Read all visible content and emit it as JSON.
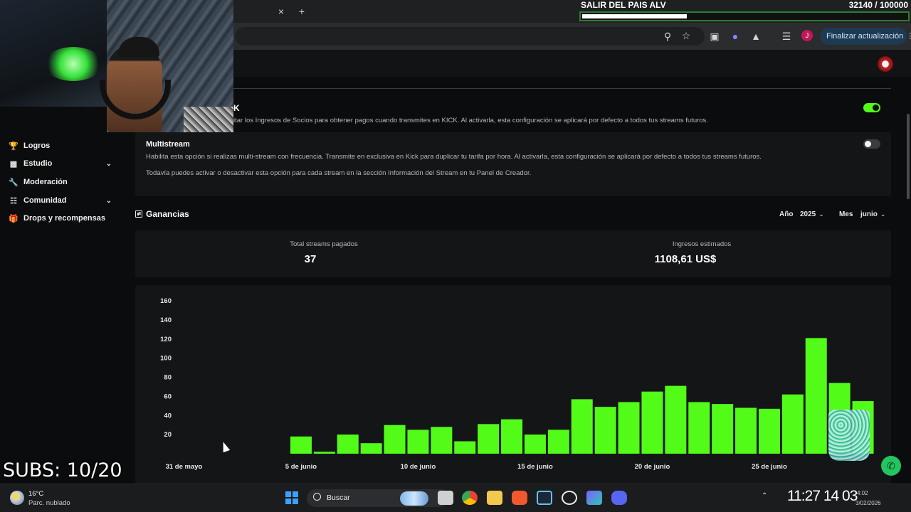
{
  "goal": {
    "title": "SALIR DEL PAIS ALV",
    "count": "32140 / 100000",
    "progress": 0.3214
  },
  "browser": {
    "update_label": "Finalizar actualización",
    "profile_initial": "J",
    "tab_close": "×",
    "new_tab": "+"
  },
  "partner": {
    "title_tail": "K",
    "description": "itar los Ingresos de Socios para obtener pagos cuando transmites en KICK. Al activarla, esta configuración se aplicará por defecto a todos tus streams futuros.",
    "enabled": true
  },
  "sidebar": {
    "items": [
      {
        "label": "Logros",
        "icon": "trophy-icon",
        "expandable": false
      },
      {
        "label": "Estudio",
        "icon": "video-icon",
        "expandable": true
      },
      {
        "label": "Moderación",
        "icon": "wrench-icon",
        "expandable": false
      },
      {
        "label": "Comunidad",
        "icon": "community-icon",
        "expandable": true
      },
      {
        "label": "Drops y recompensas",
        "icon": "gift-icon",
        "expandable": false
      }
    ]
  },
  "multistream": {
    "title": "Multistream",
    "description": "Habilita esta opción si realizas multi-stream con frecuencia. Transmite en exclusiva en Kick para duplicar tu tarifa por hora. Al activarla, esta configuración se aplicará por defecto a todos tus streams futuros.",
    "note": "Todavía puedes activar o desactivar esta opción para cada stream en la sección Información del Stream en tu Panel de Creador.",
    "enabled": false
  },
  "earnings": {
    "title": "Ganancias",
    "year_label": "Año",
    "year_value": "2025",
    "month_label": "Mes",
    "month_value": "junio",
    "stats": {
      "streams_label": "Total streams pagados",
      "streams_value": "37",
      "income_label": "Ingresos estimados",
      "income_value": "1108,61 US$"
    }
  },
  "chart_data": {
    "type": "bar",
    "color": "#53fc18",
    "ylim": [
      0,
      160
    ],
    "yticks": [
      20,
      40,
      60,
      80,
      100,
      120,
      140,
      160
    ],
    "xtick_labels": [
      "31 de mayo",
      "5 de junio",
      "10 de junio",
      "15 de junio",
      "20 de junio",
      "25 de junio"
    ],
    "xtick_positions": [
      0,
      5,
      10,
      15,
      20,
      25
    ],
    "categories": [
      "31 may",
      "1 jun",
      "2 jun",
      "3 jun",
      "4 jun",
      "5 jun",
      "6 jun",
      "7 jun",
      "8 jun",
      "9 jun",
      "10 jun",
      "11 jun",
      "12 jun",
      "13 jun",
      "14 jun",
      "15 jun",
      "16 jun",
      "17 jun",
      "18 jun",
      "19 jun",
      "20 jun",
      "21 jun",
      "22 jun",
      "23 jun",
      "24 jun",
      "25 jun",
      "26 jun",
      "27 jun",
      "28 jun",
      "29 jun",
      "30 jun"
    ],
    "values": [
      0,
      0,
      0,
      0,
      0,
      18,
      2,
      20,
      11,
      30,
      25,
      28,
      13,
      31,
      36,
      20,
      25,
      57,
      49,
      54,
      65,
      71,
      54,
      52,
      48,
      47,
      62,
      121,
      74,
      55,
      0
    ]
  },
  "overlays": {
    "subs": "SUBS: 10/20"
  },
  "taskbar": {
    "weather_temp": "16°C",
    "weather_desc": "Parc. nublado",
    "search_placeholder": "Buscar",
    "clock_big": "11:27 14 03",
    "clock_time": "4:02",
    "clock_date": "3/02/2026"
  }
}
